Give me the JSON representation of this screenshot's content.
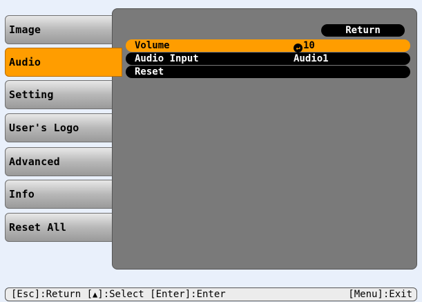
{
  "menu": {
    "items": [
      {
        "label": "Image"
      },
      {
        "label": "Audio",
        "selected": true
      },
      {
        "label": "Setting"
      },
      {
        "label": "User's Logo"
      },
      {
        "label": "Advanced"
      },
      {
        "label": "Info"
      },
      {
        "label": "Reset All"
      }
    ]
  },
  "panel": {
    "return_label": "Return",
    "rows": [
      {
        "label": "Volume",
        "value": "10",
        "value_icon": "enter-icon",
        "active": true
      },
      {
        "label": "Audio Input",
        "value": "Audio1"
      },
      {
        "label": "Reset",
        "value": ""
      }
    ]
  },
  "helpbar": {
    "esc": "[Esc]:Return",
    "select_prefix": "[",
    "select_icon": "up-down-arrow-icon",
    "select_suffix": "]:Select",
    "enter": "[Enter]:Enter",
    "menu": "[Menu]:Exit"
  },
  "colors": {
    "background": "#e9f0fb",
    "selected": "#ff9d00",
    "panel": "#7a7a7a",
    "row": "#000000"
  }
}
